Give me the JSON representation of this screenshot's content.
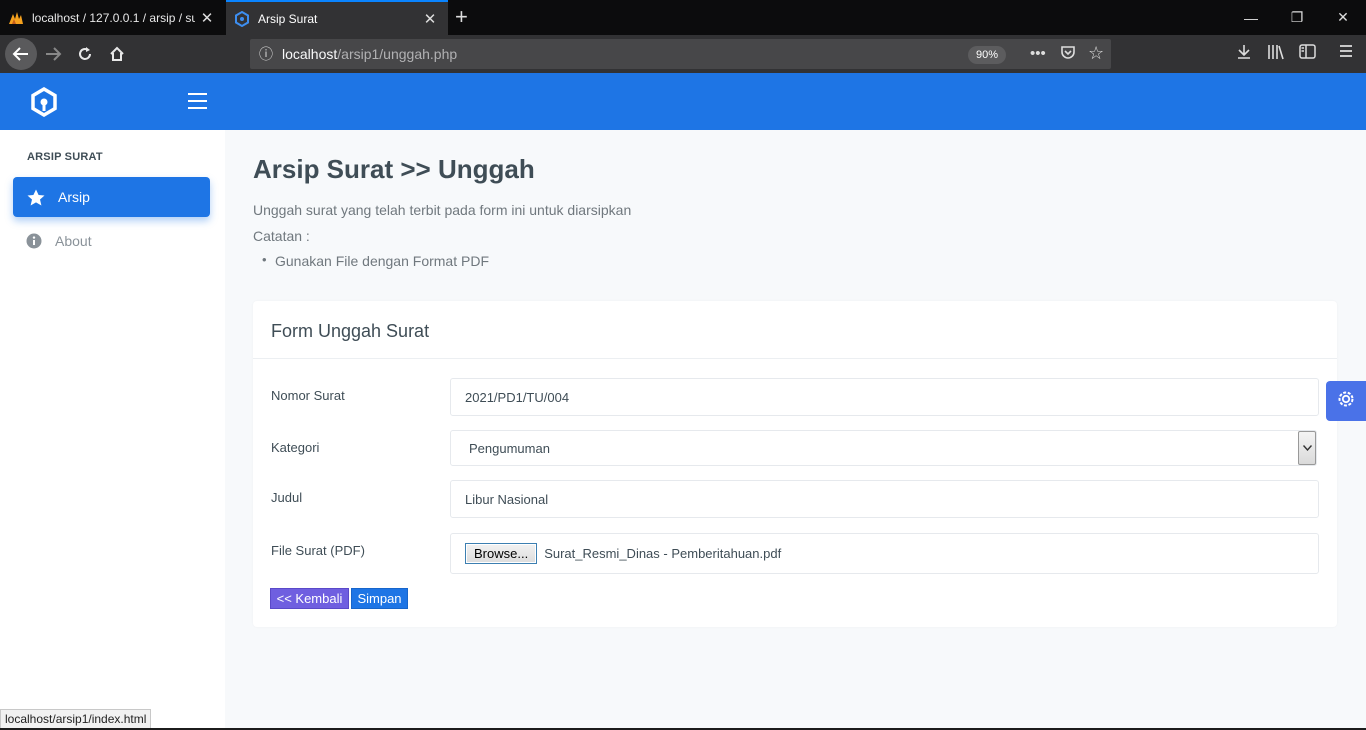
{
  "browser": {
    "tabs": [
      {
        "title": "localhost / 127.0.0.1 / arsip / surat",
        "favicon": "phpmyadmin-icon"
      },
      {
        "title": "Arsip Surat",
        "favicon": "app-logo-icon",
        "active": true
      }
    ],
    "url_host": "localhost",
    "url_path": "/arsip1/unggah.php",
    "zoom": "90%",
    "status_url": "localhost/arsip1/index.html"
  },
  "sidebar": {
    "heading": "ARSIP SURAT",
    "items": [
      {
        "label": "Arsip",
        "icon": "star-icon",
        "active": true
      },
      {
        "label": "About",
        "icon": "info-icon"
      }
    ]
  },
  "page": {
    "title": "Arsip Surat >> Unggah",
    "description": "Unggah surat yang telah terbit pada form ini untuk diarsipkan",
    "notes_label": "Catatan :",
    "notes": [
      "Gunakan File dengan Format PDF"
    ]
  },
  "form": {
    "title": "Form Unggah Surat",
    "fields": {
      "nomor": {
        "label": "Nomor Surat",
        "value": "2021/PD1/TU/004"
      },
      "kategori": {
        "label": "Kategori",
        "value": "Pengumuman"
      },
      "judul": {
        "label": "Judul",
        "value": "Libur Nasional"
      },
      "file": {
        "label": "File Surat (PDF)",
        "button": "Browse...",
        "value": "Surat_Resmi_Dinas - Pemberitahuan.pdf"
      }
    },
    "back_button": "<< Kembali",
    "save_button": "Simpan"
  },
  "colors": {
    "primary": "#1e75e5",
    "back_button": "#6f5fe0",
    "settings_fab": "#4a72e8"
  }
}
